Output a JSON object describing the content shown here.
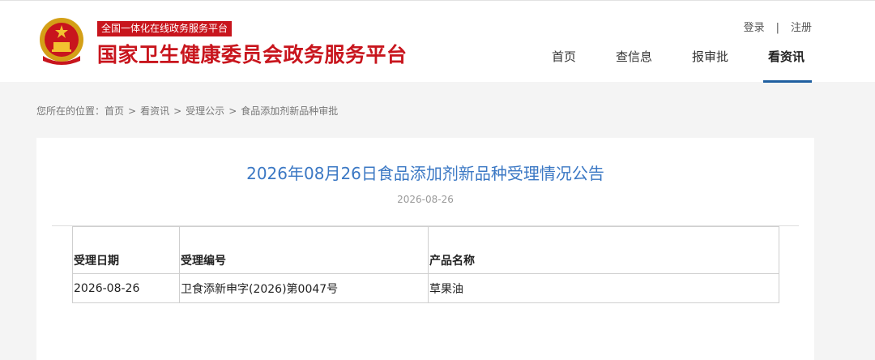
{
  "header": {
    "emblem_icon": "national-emblem-icon",
    "tagline": "全国一体化在线政务服务平台",
    "site_name": "国家卫生健康委员会政务服务平台",
    "auth": {
      "login": "登录",
      "separator": "|",
      "register": "注册"
    },
    "nav": [
      {
        "label": "首页",
        "active": false
      },
      {
        "label": "查信息",
        "active": false
      },
      {
        "label": "报审批",
        "active": false
      },
      {
        "label": "看资讯",
        "active": true
      }
    ],
    "brand_color": "#c8151d",
    "accent_color": "#1f5fa0"
  },
  "breadcrumb": {
    "prefix": "您所在的位置：",
    "items": [
      "首页",
      "看资讯",
      "受理公示",
      "食品添加剂新品种审批"
    ],
    "separator": ">"
  },
  "article": {
    "title": "2026年08月26日食品添加剂新品种受理情况公告",
    "date": "2026-08-26",
    "title_color": "#3b78c4",
    "table": {
      "headers": [
        "受理日期",
        "受理编号",
        "产品名称"
      ],
      "rows": [
        [
          "2026-08-26",
          "卫食添新申字(2026)第0047号",
          "草果油"
        ]
      ]
    }
  }
}
